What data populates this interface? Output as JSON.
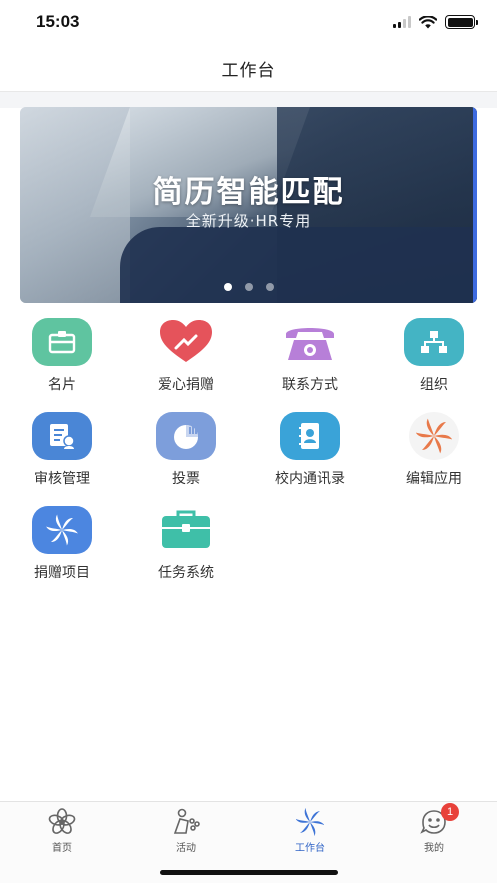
{
  "status_bar": {
    "time": "15:03"
  },
  "header": {
    "title": "工作台"
  },
  "banner": {
    "title": "简历智能匹配",
    "subtitle": "全新升级·HR专用",
    "page_count": 3,
    "active_page": 1
  },
  "apps": [
    {
      "label": "名片",
      "icon": "business-card-icon",
      "color": "#5fc4a0"
    },
    {
      "label": "爱心捐赠",
      "icon": "heart-donation-icon",
      "color": "#e5535b"
    },
    {
      "label": "联系方式",
      "icon": "telephone-icon",
      "color": "#b77fd8"
    },
    {
      "label": "组织",
      "icon": "org-chart-icon",
      "color": "#44b4c4"
    },
    {
      "label": "审核管理",
      "icon": "audit-icon",
      "color": "#4a86d6"
    },
    {
      "label": "投票",
      "icon": "vote-chart-icon",
      "color": "#7d9edb"
    },
    {
      "label": "校内通讯录",
      "icon": "address-book-icon",
      "color": "#3aa3d8"
    },
    {
      "label": "编辑应用",
      "icon": "pinwheel-icon",
      "color": "#e8794a"
    },
    {
      "label": "捐赠项目",
      "icon": "pinwheel-blue-icon",
      "color": "#4c86e0"
    },
    {
      "label": "任务系统",
      "icon": "briefcase-icon",
      "color": "#3fbfa8"
    }
  ],
  "tab_bar": {
    "tabs": [
      {
        "label": "首页",
        "icon": "home-flower-icon"
      },
      {
        "label": "活动",
        "icon": "activity-people-icon"
      },
      {
        "label": "工作台",
        "icon": "workbench-pinwheel-icon",
        "active": true
      },
      {
        "label": "我的",
        "icon": "profile-face-icon",
        "badge": "1"
      }
    ]
  }
}
